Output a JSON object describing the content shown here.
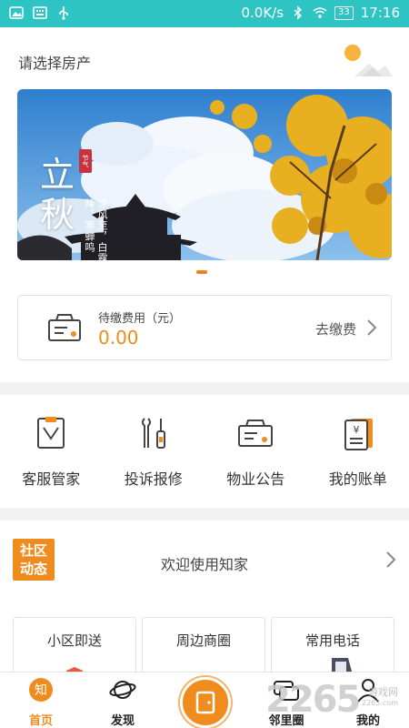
{
  "status_bar": {
    "speed": "0.0K/s",
    "battery": "33",
    "time": "17:16"
  },
  "property": {
    "label": "请选择房产",
    "weather_icon": "sun-cloud-icon"
  },
  "banner": {
    "title_line1": "立",
    "title_line2": "秋",
    "stamp": "节气",
    "poem": "凉风至，白露降，寒蝉鸣"
  },
  "fee": {
    "label": "待缴费用（元）",
    "amount": "0.00",
    "pay_label": "去缴费"
  },
  "services": [
    {
      "label": "客服管家",
      "icon": "butler-icon"
    },
    {
      "label": "投诉报修",
      "icon": "repair-tools-icon"
    },
    {
      "label": "物业公告",
      "icon": "notice-icon"
    },
    {
      "label": "我的账单",
      "icon": "bill-icon"
    }
  ],
  "community": {
    "logo_line1": "社区",
    "logo_line2": "动态",
    "welcome": "欢迎使用知家"
  },
  "feature_cards": [
    {
      "label": "小区即送"
    },
    {
      "label": "周边商圈"
    },
    {
      "label": "常用电话"
    }
  ],
  "tab_bar": {
    "tabs": [
      {
        "label": "首页",
        "icon": "home-zhi-icon",
        "active": true
      },
      {
        "label": "发现",
        "icon": "planet-icon",
        "active": false
      },
      {
        "label": "邻里圈",
        "icon": "chat-bubbles-icon",
        "active": false
      },
      {
        "label": "我的",
        "icon": "user-icon",
        "active": false
      }
    ],
    "center_icon": "door-icon"
  },
  "watermark": {
    "brand": "2265",
    "suffix": "游戏网",
    "url": "2265.com"
  },
  "colors": {
    "status_bar": "#2ec4c4",
    "accent": "#f08c1e"
  }
}
